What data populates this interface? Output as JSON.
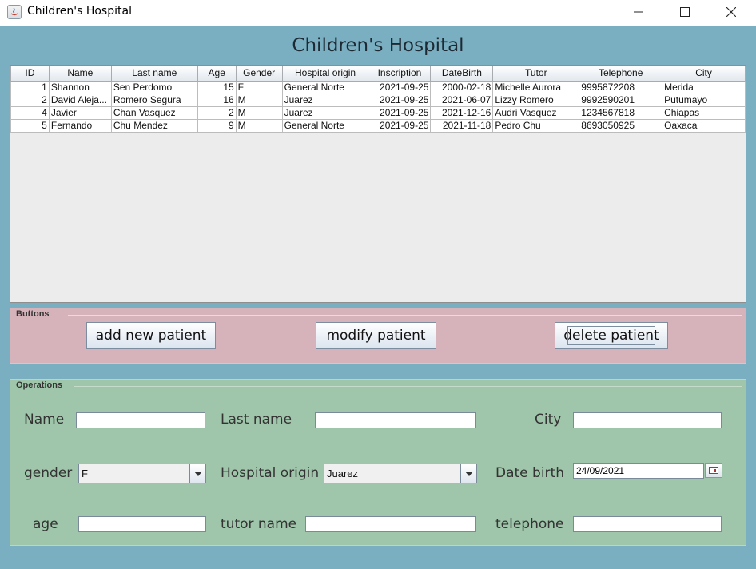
{
  "window": {
    "title": "Children's Hospital",
    "heading": "Children's Hospital"
  },
  "table": {
    "columns": [
      "ID",
      "Name",
      "Last name",
      "Age",
      "Gender",
      "Hospital origin",
      "Inscription",
      "DateBirth",
      "Tutor",
      "Telephone",
      "City"
    ],
    "rows": [
      [
        "1",
        "Shannon",
        "Sen Perdomo",
        "15",
        "F",
        "General Norte",
        "2021-09-25",
        "2000-02-18",
        "Michelle Aurora",
        "9995872208",
        "Merida"
      ],
      [
        "2",
        "David Aleja...",
        "Romero Segura",
        "16",
        "M",
        "Juarez",
        "2021-09-25",
        "2021-06-07",
        "Lizzy Romero",
        "9992590201",
        "Putumayo"
      ],
      [
        "4",
        "Javier",
        "Chan Vasquez",
        "2",
        "M",
        "Juarez",
        "2021-09-25",
        "2021-12-16",
        "Audri Vasquez",
        "1234567818",
        "Chiapas"
      ],
      [
        "5",
        "Fernando",
        "Chu Mendez",
        "9",
        "M",
        "General Norte",
        "2021-09-25",
        "2021-11-18",
        "Pedro Chu",
        "8693050925",
        "Oaxaca"
      ]
    ]
  },
  "buttons_panel": {
    "title": "Buttons",
    "add_label": "add new patient",
    "modify_label": "modify patient",
    "delete_label": "delete patient"
  },
  "operations": {
    "title": "Operations",
    "name_label": "Name",
    "name_value": "",
    "lastname_label": "Last name",
    "lastname_value": "",
    "city_label": "City",
    "city_value": "",
    "gender_label": "gender",
    "gender_value": "F",
    "hospital_label": "Hospital origin",
    "hospital_value": "Juarez",
    "datebirth_label": "Date birth",
    "datebirth_value": "24/09/2021",
    "age_label": "age",
    "age_value": "",
    "tutor_label": "tutor name",
    "tutor_value": "",
    "telephone_label": "telephone",
    "telephone_value": ""
  },
  "colors": {
    "background": "#7aafc1",
    "buttons_panel": "#d6b3bb",
    "operations_panel": "#9fc6aa"
  },
  "icons": [
    "java-app-icon",
    "minimize-icon",
    "maximize-icon",
    "close-icon",
    "chevron-down-icon",
    "calendar-icon"
  ]
}
